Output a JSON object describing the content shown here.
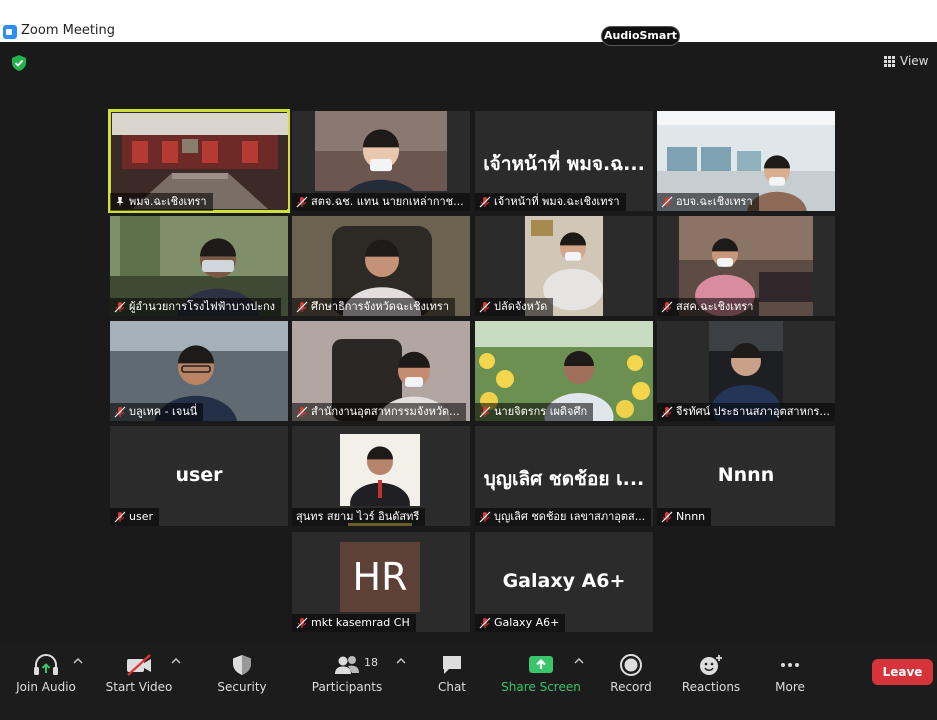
{
  "window": {
    "title": "Zoom Meeting"
  },
  "badge": "AudioSmart",
  "view_button": "View",
  "participants": [
    {
      "name": "พมจ.ฉะเชิงเทรา",
      "video": "room",
      "pinned": true
    },
    {
      "name": "สตจ.ฉช. แทน นายกเหล่ากาช...",
      "video": "woman"
    },
    {
      "name": "เจ้าหน้าที่ พมจ.ฉะเชิงเทรา",
      "big": "เจ้าหน้าที่ พมจ.ฉ..."
    },
    {
      "name": "อบจ.ฉะเชิงเทรา",
      "video": "office"
    },
    {
      "name": "ผู้อำนวยการโรงไฟฟ้าบางปะกง",
      "video": "man-bald"
    },
    {
      "name": "ศึกษาธิการจังหวัดฉะเชิงเทรา",
      "video": "man-chair"
    },
    {
      "name": "ปลัดจังหวัด",
      "video": "man-mask"
    },
    {
      "name": "สสค.ฉะเชิงเทรา",
      "video": "woman2"
    },
    {
      "name": "บลูเทค - เจนนี่",
      "video": "man-glasses"
    },
    {
      "name": "สำนักงานอุตสาหกรรมจังหวัด...",
      "video": "man-chair2"
    },
    {
      "name": "นายจิตรกร เผดิจศึก",
      "video": "melon"
    },
    {
      "name": "จีรทัศน์ ประธานสภาอุตสาหกร...",
      "video": "man-car"
    },
    {
      "name": "user",
      "big": "user"
    },
    {
      "name": "สุนทร สยาม ไวร์ อินดัสทรี",
      "video": "portrait",
      "nomic": true
    },
    {
      "name": "บุญเลิศ ชดช้อย เลขาสภาอุตส...",
      "big": "บุญเลิศ ชดช้อย เ..."
    },
    {
      "name": "Nnnn",
      "big": "Nnnn"
    },
    {
      "name": "mkt kasemrad  CH",
      "initials": "HR"
    },
    {
      "name": "Galaxy A6+",
      "big": "Galaxy A6+"
    }
  ],
  "toolbar": {
    "join_audio": "Join Audio",
    "start_video": "Start Video",
    "security": "Security",
    "participants": "Participants",
    "participants_count": "18",
    "chat": "Chat",
    "share_screen": "Share Screen",
    "record": "Record",
    "reactions": "Reactions",
    "more": "More",
    "leave": "Leave"
  },
  "colors": {
    "share_green": "#3ac46b",
    "leave_red": "#d6343a",
    "active_border": "#cfe03a"
  }
}
